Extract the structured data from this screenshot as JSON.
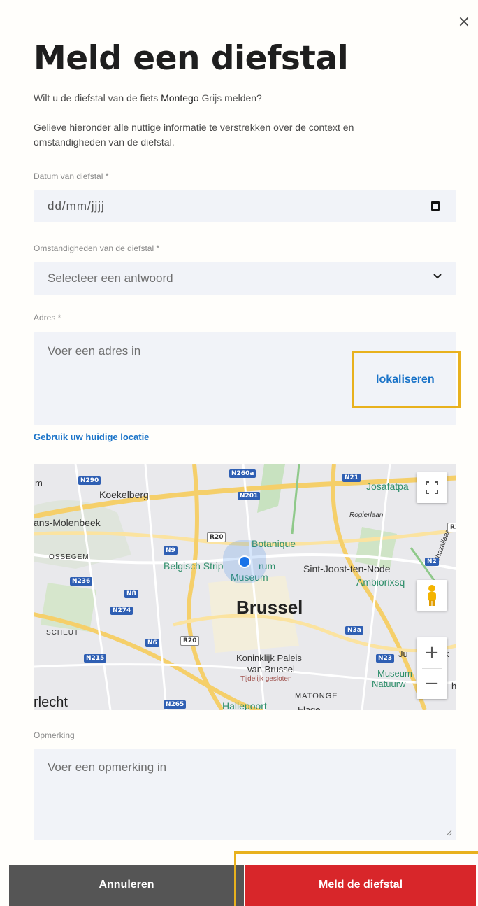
{
  "dialog": {
    "close_label": "×",
    "title": "Meld een diefstal",
    "intro": {
      "prefix": "Wilt u de diefstal van de fiets",
      "bike_model": "Montego",
      "bike_color": "Grijs",
      "suffix": "melden?"
    },
    "description": "Gelieve hieronder alle nuttige informatie te verstrekken over de context en omstandigheden van de diefstal."
  },
  "form": {
    "date": {
      "label": "Datum van diefstal *",
      "placeholder_dd": "dd",
      "placeholder_mm": "mm",
      "placeholder_yyyy": "jjjj",
      "sep": "/"
    },
    "circumstances": {
      "label": "Omstandigheden van de diefstal *",
      "selected": "Selecteer een antwoord"
    },
    "address": {
      "label": "Adres *",
      "placeholder": "Voer een adres in",
      "localize_button": "lokaliseren",
      "use_location_link": "Gebruik uw huidige locatie"
    },
    "comment": {
      "label": "Opmerking",
      "placeholder": "Voer een opmerking in"
    }
  },
  "map": {
    "labels": {
      "koekelberg": "Koekelberg",
      "molenbeek": "ans-Molenbeek",
      "ossegem": "OSSEGEM",
      "scheut": "SCHEUT",
      "brussel": "Brussel",
      "botanique": "Botanique",
      "stripmuseum_a": "Belgisch Strip",
      "stripmuseum_b": "rum",
      "stripmuseum_c": "Museum",
      "sint_joost": "Sint-Joost-ten-Node",
      "ambiorix": "Ambiorixsq",
      "josafat": "Josafatpa",
      "rogier": "Rogierlaan",
      "chazal": "Chazallaan",
      "paleis_a": "Koninklijk Paleis",
      "paleis_b": "van Brussel",
      "paleis_c": "Tijdelijk gesloten",
      "museum_a": "Museum",
      "museum_b": "Natuurw",
      "matonge": "MATONGE",
      "hallepoort": "Hallepoort",
      "anderlecht": "rlecht",
      "m": "m",
      "ju": "Ju",
      "k": "k",
      "h": "h",
      "flagey": "Flage"
    },
    "roads": [
      "N290",
      "N260a",
      "N21",
      "N201",
      "R20",
      "N9",
      "N236",
      "N8",
      "N274",
      "N6",
      "R20",
      "N215",
      "N265",
      "N3a",
      "N23",
      "N2",
      "R2"
    ],
    "zoom_in": "+",
    "zoom_out": "−"
  },
  "actions": {
    "cancel": "Annuleren",
    "submit": "Meld de diefstal"
  },
  "colors": {
    "accent_blue": "#1a73c8",
    "submit_red": "#d8262a",
    "highlight": "#e8b11d",
    "cancel_grey": "#555555"
  }
}
